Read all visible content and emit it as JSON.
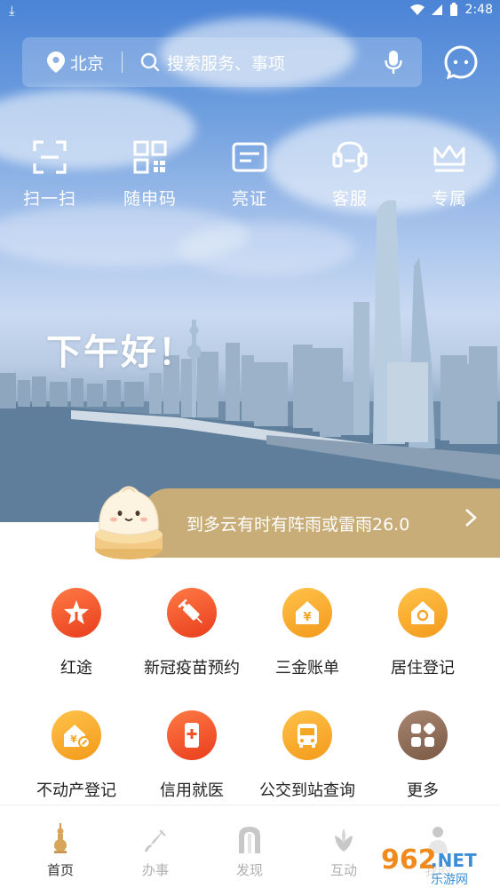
{
  "status_bar": {
    "time": "2:48"
  },
  "search": {
    "city": "北京",
    "placeholder": "搜索服务、事项"
  },
  "quick_actions": [
    {
      "label": "扫一扫",
      "icon": "scan-icon"
    },
    {
      "label": "随申码",
      "icon": "qr-code-icon"
    },
    {
      "label": "亮证",
      "icon": "card-icon"
    },
    {
      "label": "客服",
      "icon": "headset-icon"
    },
    {
      "label": "专属",
      "icon": "crown-icon"
    }
  ],
  "greeting": "下午好！",
  "weather": {
    "text": "到多云有时有阵雨或雷雨26.0"
  },
  "services": [
    {
      "label": "红途",
      "icon": "star-flag-icon",
      "color": "#f0542b"
    },
    {
      "label": "新冠疫苗预约",
      "icon": "syringe-icon",
      "color": "#f0542b"
    },
    {
      "label": "三金账单",
      "icon": "house-yuan-icon",
      "color": "#f5a623"
    },
    {
      "label": "居住登记",
      "icon": "house-icon",
      "color": "#f5a623"
    },
    {
      "label": "不动产登记",
      "icon": "property-icon",
      "color": "#f5a623"
    },
    {
      "label": "信用就医",
      "icon": "phone-medical-icon",
      "color": "#f0542b"
    },
    {
      "label": "公交到站查询",
      "icon": "bus-icon",
      "color": "#f5a623"
    },
    {
      "label": "更多",
      "icon": "more-apps-icon",
      "color": "#8c6a52"
    }
  ],
  "bottom_nav": [
    {
      "label": "首页",
      "icon": "pagoda-icon",
      "active": true
    },
    {
      "label": "办事",
      "icon": "pen-icon",
      "active": false
    },
    {
      "label": "发现",
      "icon": "arch-icon",
      "active": false
    },
    {
      "label": "互动",
      "icon": "magnolia-icon",
      "active": false
    },
    {
      "label": "我的",
      "icon": "person-icon",
      "active": false
    }
  ],
  "watermark": {
    "brand": "962",
    "domain": ".NET",
    "sub": "乐游网"
  }
}
